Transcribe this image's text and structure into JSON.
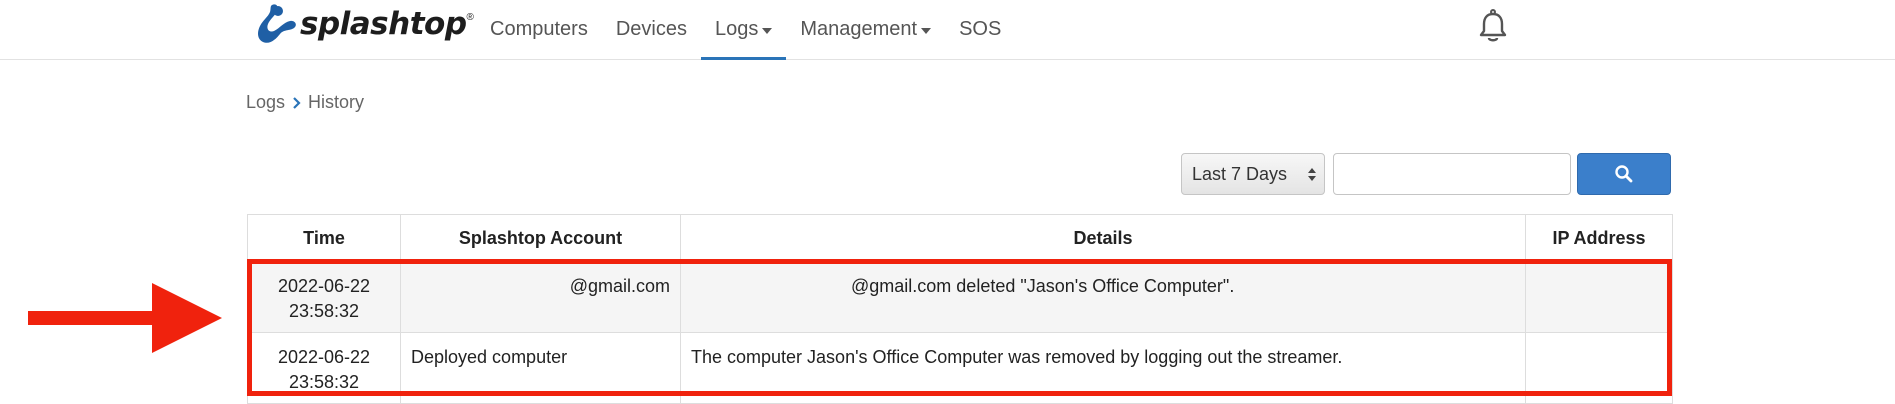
{
  "header": {
    "brand": "splashtop",
    "brand_mark": "®",
    "nav": [
      {
        "label": "Computers",
        "dropdown": false,
        "active": false
      },
      {
        "label": "Devices",
        "dropdown": false,
        "active": false
      },
      {
        "label": "Logs",
        "dropdown": true,
        "active": true
      },
      {
        "label": "Management",
        "dropdown": true,
        "active": false
      },
      {
        "label": "SOS",
        "dropdown": false,
        "active": false
      }
    ],
    "notification_icon": "bell-icon"
  },
  "breadcrumb": {
    "parent": "Logs",
    "current": "History"
  },
  "filter": {
    "range_selected": "Last 7 Days",
    "search_value": "",
    "search_placeholder": "",
    "search_icon": "search-icon"
  },
  "table": {
    "columns": [
      "Time",
      "Splashtop Account",
      "Details",
      "IP Address"
    ],
    "rows": [
      {
        "time_date": "2022-06-22",
        "time_clock": "23:58:32",
        "account": "@gmail.com",
        "details": "@gmail.com deleted \"Jason's Office Computer\".",
        "ip": ""
      },
      {
        "time_date": "2022-06-22",
        "time_clock": "23:58:32",
        "account": "Deployed computer",
        "details": "The computer Jason's Office Computer was removed by logging out the streamer.",
        "ip": ""
      }
    ]
  },
  "colors": {
    "accent": "#2a74b8",
    "button": "#3b7fcb",
    "annotation": "#f0220d"
  }
}
